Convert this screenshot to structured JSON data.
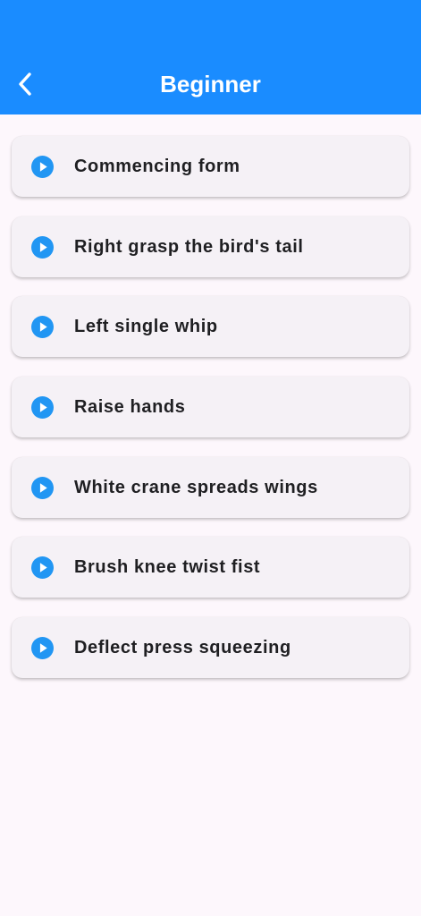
{
  "header": {
    "title": "Beginner",
    "back_icon": "chevron-left-icon",
    "background_color": "#1a8cff",
    "title_color": "#ffffff"
  },
  "lessons": [
    {
      "label": "Commencing form",
      "icon": "play-circle-icon"
    },
    {
      "label": "Right grasp the bird's tail",
      "icon": "play-circle-icon"
    },
    {
      "label": "Left single whip",
      "icon": "play-circle-icon"
    },
    {
      "label": "Raise hands",
      "icon": "play-circle-icon"
    },
    {
      "label": "White crane spreads wings",
      "icon": "play-circle-icon"
    },
    {
      "label": "Brush knee twist fist",
      "icon": "play-circle-icon"
    },
    {
      "label": "Deflect press squeezing",
      "icon": "play-circle-icon"
    }
  ],
  "colors": {
    "accent": "#2196f3",
    "page_background": "#fdf7fc",
    "card_background": "#f5f1f6",
    "text": "#1f1f22"
  }
}
